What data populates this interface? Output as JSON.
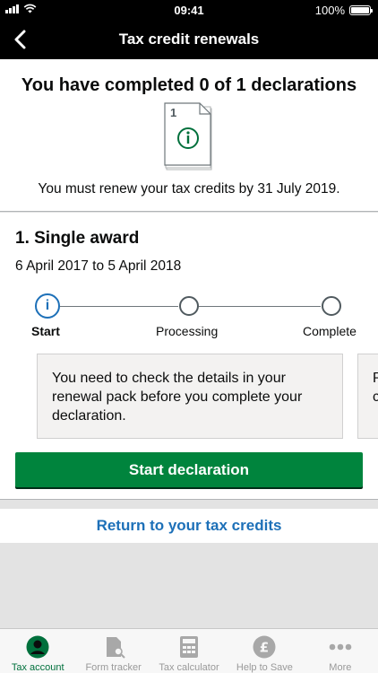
{
  "status_bar": {
    "time": "09:41",
    "battery": "100%"
  },
  "nav": {
    "title": "Tax credit renewals"
  },
  "summary": {
    "heading": "You have completed 0 of 1 declarations",
    "doc_number": "1",
    "subtext": "You must renew your tax credits by 31 July 2019."
  },
  "award": {
    "title": "1. Single award",
    "dates": "6 April 2017 to 5 April 2018",
    "steps": [
      {
        "label": "Start"
      },
      {
        "label": "Processing"
      },
      {
        "label": "Complete"
      }
    ],
    "info_text": "You need to check the details in your renewal pack before you complete your declaration.",
    "next_card_text": "P c",
    "button_label": "Start declaration"
  },
  "return_link": "Return to your tax credits",
  "tabs": [
    {
      "label": "Tax account"
    },
    {
      "label": "Form tracker"
    },
    {
      "label": "Tax calculator"
    },
    {
      "label": "Help to Save"
    },
    {
      "label": "More"
    }
  ],
  "colors": {
    "accent_green": "#00843d",
    "link_blue": "#1d70b8",
    "tab_active": "#00703c"
  }
}
